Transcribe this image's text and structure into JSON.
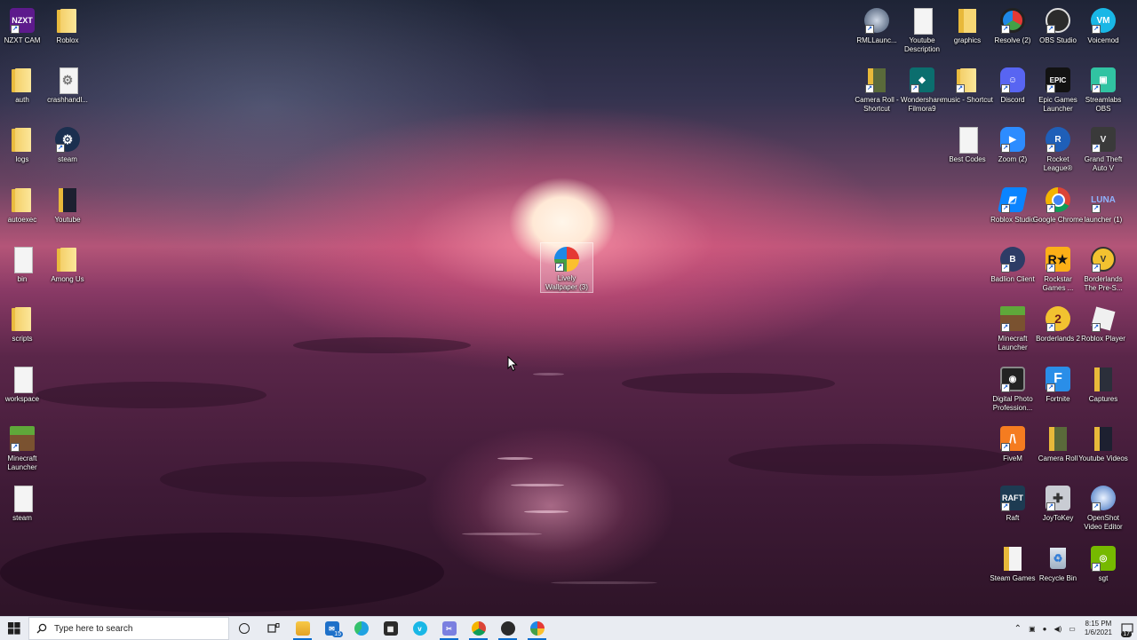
{
  "desktop": {
    "left_column_1": [
      {
        "label": "NZXT CAM",
        "icon": "nzxt-cam-icon"
      },
      {
        "label": "auth",
        "icon": "folder-icon"
      },
      {
        "label": "logs",
        "icon": "folder-icon"
      },
      {
        "label": "autoexec",
        "icon": "folder-icon"
      },
      {
        "label": "bin",
        "icon": "folder-icon"
      },
      {
        "label": "scripts",
        "icon": "folder-icon"
      },
      {
        "label": "workspace",
        "icon": "folder-icon"
      },
      {
        "label": "Minecraft Launcher",
        "icon": "minecraft-icon"
      },
      {
        "label": "steam",
        "icon": "folder-icon"
      }
    ],
    "left_column_2": [
      {
        "label": "Roblox",
        "icon": "folder-icon"
      },
      {
        "label": "crashhandl...",
        "icon": "settings-file-icon"
      },
      {
        "label": "steam",
        "icon": "steam-icon"
      },
      {
        "label": "Youtube",
        "icon": "folder-icon"
      },
      {
        "label": "Among Us",
        "icon": "folder-icon"
      }
    ],
    "center_icon": {
      "label": "Lively Wallpaper (3)",
      "icon": "lively-wallpaper-icon"
    },
    "right_grid": [
      {
        "label": "RMLLaunc...",
        "icon": "rml-launcher-icon"
      },
      {
        "label": "Youtube Description",
        "icon": "document-icon"
      },
      {
        "label": "graphics",
        "icon": "folder-icon"
      },
      {
        "label": "Resolve (2)",
        "icon": "davinci-resolve-icon"
      },
      {
        "label": "OBS Studio",
        "icon": "obs-icon"
      },
      {
        "label": "Voicemod",
        "icon": "voicemod-icon"
      },
      {
        "label": "Camera Roll - Shortcut",
        "icon": "folder-icon"
      },
      {
        "label": "Wondershare Filmora9",
        "icon": "filmora-icon"
      },
      {
        "label": "music - Shortcut",
        "icon": "folder-icon"
      },
      {
        "label": "Discord",
        "icon": "discord-icon"
      },
      {
        "label": "Epic Games Launcher",
        "icon": "epic-games-icon"
      },
      {
        "label": "Streamlabs OBS",
        "icon": "streamlabs-icon"
      },
      {
        "label": "Best Codes",
        "icon": "document-icon"
      },
      {
        "label": "Zoom (2)",
        "icon": "zoom-icon"
      },
      {
        "label": "Rocket League®",
        "icon": "rocket-league-icon"
      },
      {
        "label": "Grand Theft Auto V",
        "icon": "gta-icon"
      },
      {
        "label": "Roblox Studio",
        "icon": "roblox-studio-icon"
      },
      {
        "label": "Google Chrome",
        "icon": "chrome-icon"
      },
      {
        "label": "launcher (1)",
        "icon": "luna-launcher-icon"
      },
      {
        "label": "Badlion Client",
        "icon": "badlion-icon"
      },
      {
        "label": "Rockstar Games ...",
        "icon": "rockstar-icon"
      },
      {
        "label": "Borderlands The Pre-S...",
        "icon": "borderlands-icon"
      },
      {
        "label": "Minecraft Launcher",
        "icon": "minecraft-icon"
      },
      {
        "label": "Borderlands 2",
        "icon": "borderlands-2-icon"
      },
      {
        "label": "Roblox Player",
        "icon": "roblox-player-icon"
      },
      {
        "label": "Digital Photo Profession...",
        "icon": "digital-photo-icon"
      },
      {
        "label": "Fortnite",
        "icon": "fortnite-icon"
      },
      {
        "label": "Captures",
        "icon": "folder-icon"
      },
      {
        "label": "FiveM",
        "icon": "fivem-icon"
      },
      {
        "label": "Camera Roll",
        "icon": "folder-icon"
      },
      {
        "label": "Youtube Videos",
        "icon": "folder-icon"
      },
      {
        "label": "Raft",
        "icon": "raft-icon"
      },
      {
        "label": "JoyToKey",
        "icon": "joytokey-icon"
      },
      {
        "label": "OpenShot Video Editor",
        "icon": "openshot-icon"
      },
      {
        "label": "Steam Games",
        "icon": "folder-icon"
      },
      {
        "label": "Recycle Bin",
        "icon": "recycle-bin-icon"
      },
      {
        "label": "sgt",
        "icon": "nvidia-icon"
      }
    ]
  },
  "taskbar": {
    "search_placeholder": "Type here to search",
    "mail_badge": "15",
    "apps": [
      "cortana-icon",
      "task-view-icon",
      "file-explorer-icon",
      "mail-icon",
      "edge-icon",
      "store-icon",
      "voicemod-icon",
      "snipping-icon",
      "chrome-icon",
      "obs-icon",
      "lively-wallpaper-icon"
    ],
    "time": "8:15 PM",
    "date": "1/6/2021",
    "notification_count": "17"
  },
  "colors": {
    "taskbar_bg": "#e9ecf2",
    "accent": "#0a6cce"
  }
}
